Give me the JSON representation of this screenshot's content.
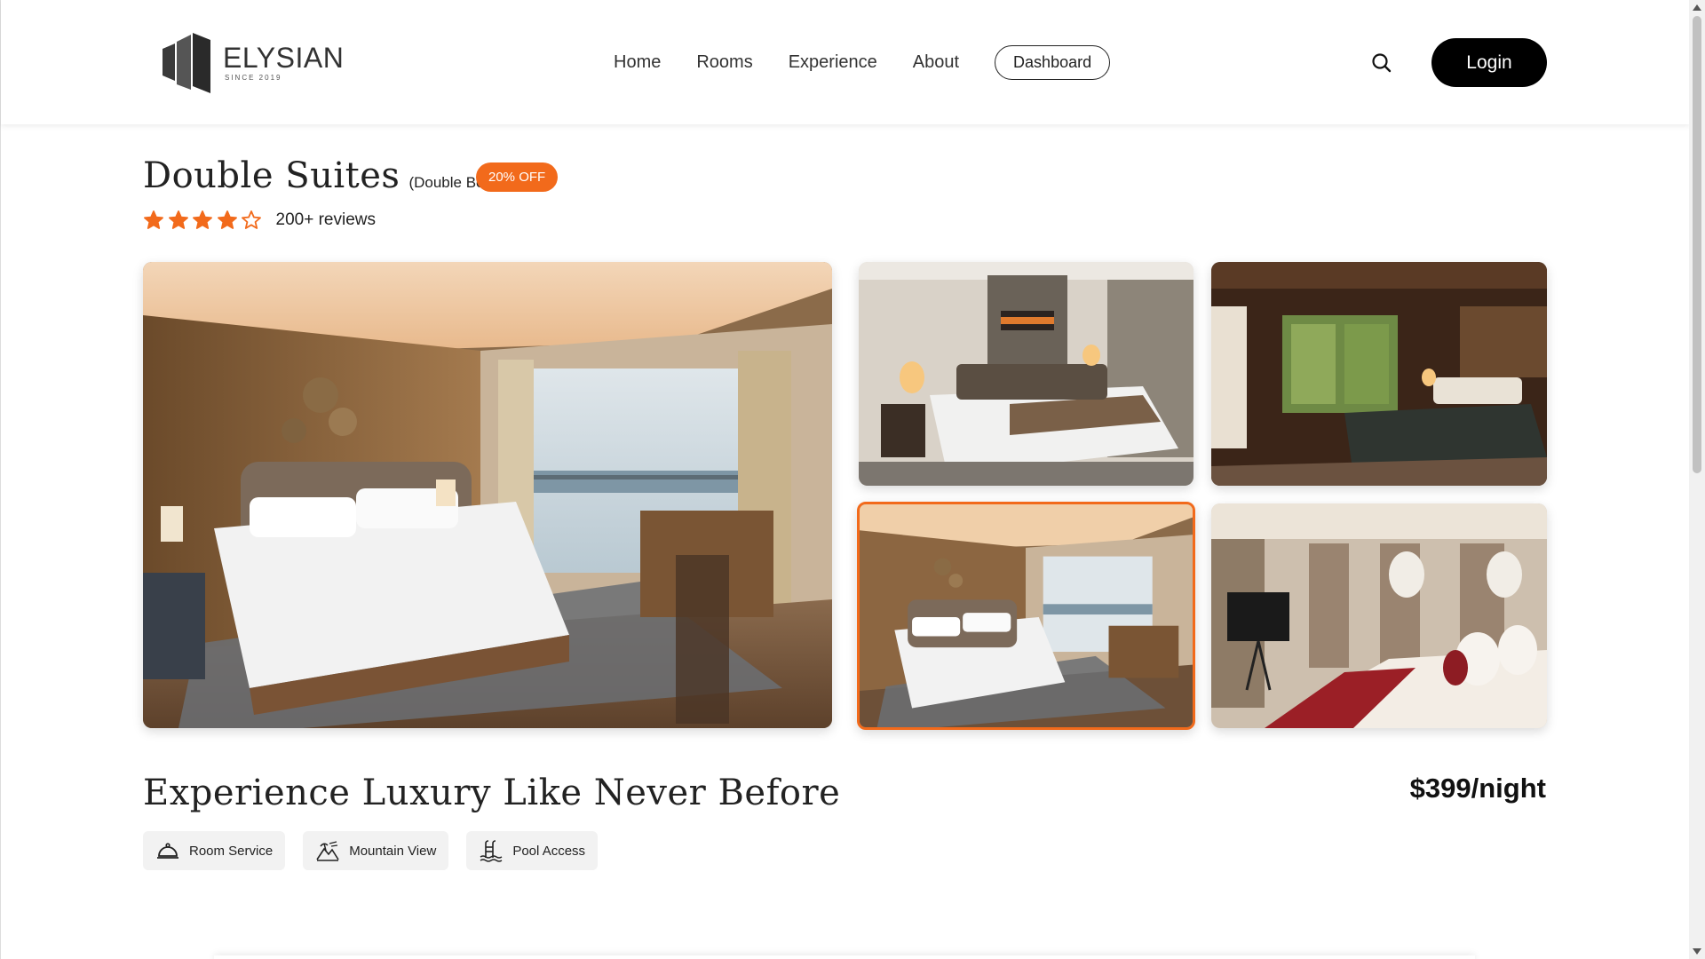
{
  "brand": {
    "name": "ELYSIAN",
    "tagline": "SINCE 2019"
  },
  "nav": {
    "items": [
      "Home",
      "Rooms",
      "Experience",
      "About"
    ],
    "dashboard": "Dashboard",
    "login": "Login"
  },
  "room": {
    "title": "Double Suites",
    "subtitle": "(Double Bed)",
    "badge": "20% OFF",
    "rating": 4,
    "rating_max": 5,
    "reviews": "200+ reviews"
  },
  "gallery": {
    "main": "Hotel room with double bed and balcony sea view",
    "thumbs": [
      "Suite with lamps and bed runner",
      "Dark wood room with garden window",
      "Selected: sea view room",
      "Bright room with red throw and TV"
    ],
    "selected_index": 2
  },
  "section": {
    "title": "Experience Luxury Like Never Before",
    "price": "$399/night"
  },
  "amenities": [
    {
      "label": "Room Service",
      "icon": "room-service-icon"
    },
    {
      "label": "Mountain View",
      "icon": "mountain-view-icon"
    },
    {
      "label": "Pool Access",
      "icon": "pool-icon"
    }
  ],
  "colors": {
    "accent": "#f26a1b",
    "dark": "#000000"
  }
}
